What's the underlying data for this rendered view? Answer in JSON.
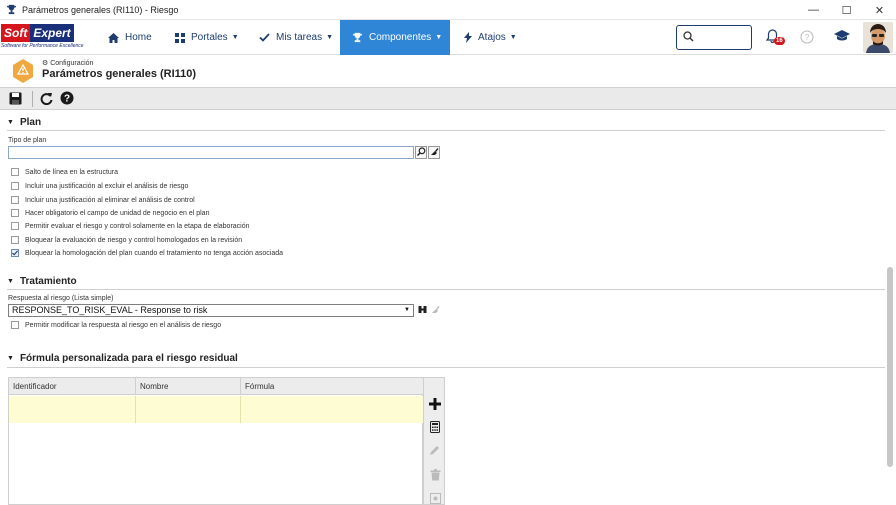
{
  "window": {
    "title": "Parámetros generales (RI110) - Riesgo",
    "minimize": "—",
    "maximize": "☐",
    "close": "✕"
  },
  "logo": {
    "part1": "Soft",
    "part2": "Expert",
    "tagline": "Software for Performance Excellence"
  },
  "nav": {
    "items": [
      {
        "label": "Home",
        "icon": "home-icon"
      },
      {
        "label": "Portales",
        "icon": "grid-icon"
      },
      {
        "label": "Mis tareas",
        "icon": "check-icon"
      },
      {
        "label": "Componentes",
        "icon": "trophy-icon"
      },
      {
        "label": "Atajos",
        "icon": "bolt-icon"
      }
    ],
    "notifications_count": "16"
  },
  "page": {
    "breadcrumb": "Configuración",
    "title": "Parámetros generales (RI110)"
  },
  "plan": {
    "section_title": "Plan",
    "tipo_label": "Tipo de plan",
    "tipo_value": "",
    "options": [
      {
        "label": "Salto de línea en la estructura",
        "checked": false
      },
      {
        "label": "Incluir una justificación al excluir el análisis de riesgo",
        "checked": false
      },
      {
        "label": "Incluir una justificación al eliminar el análisis de control",
        "checked": false
      },
      {
        "label": "Hacer obligatorio el campo de unidad de negocio en el plan",
        "checked": false
      },
      {
        "label": "Permitir evaluar el riesgo y control solamente en la etapa de elaboración",
        "checked": false
      },
      {
        "label": "Bloquear la evaluación de riesgo y control homologados en la revisión",
        "checked": false
      },
      {
        "label": "Bloquear la homologación del plan cuando el tratamiento no tenga acción asociada",
        "checked": true
      }
    ]
  },
  "tratamiento": {
    "section_title": "Tratamiento",
    "respuesta_label": "Respuesta al riesgo (Lista simple)",
    "respuesta_value": "RESPONSE_TO_RISK_EVAL - Response to risk",
    "option_label": "Permitir modificar la respuesta al riesgo en el análisis de riesgo"
  },
  "formula": {
    "section_title": "Fórmula personalizada para el riesgo residual",
    "columns": [
      "Identificador",
      "Nombre",
      "Fórmula"
    ]
  },
  "colors": {
    "accent": "#2f86d6",
    "nav_text": "#1d3d6e",
    "row_highlight": "#fdfcd2"
  }
}
